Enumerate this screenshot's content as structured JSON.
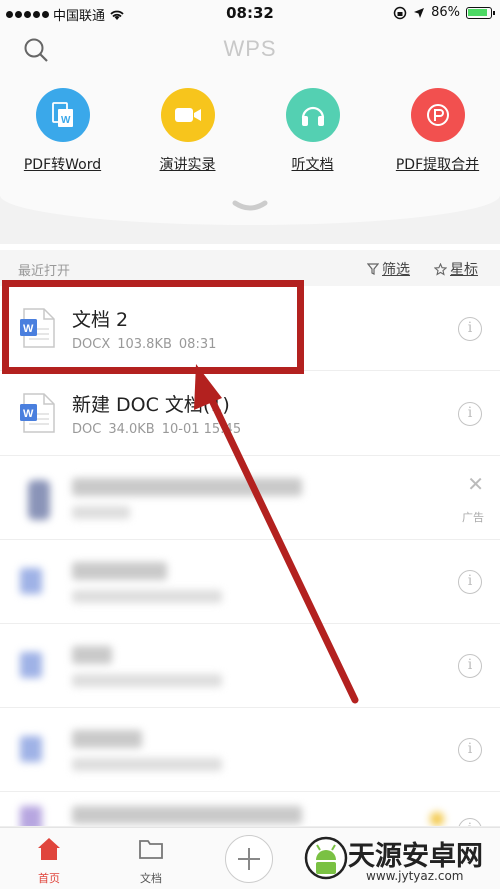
{
  "status_bar": {
    "carrier": "中国联通",
    "time": "08:32",
    "battery": "86%"
  },
  "header": {
    "logo": "WPS"
  },
  "tools": [
    {
      "label": "PDF转Word",
      "icon": "pdf-to-word-icon",
      "color": "#3aa8ea"
    },
    {
      "label": "演讲实录",
      "icon": "video-camera-icon",
      "color": "#f7c51c"
    },
    {
      "label": "听文档",
      "icon": "headphones-icon",
      "color": "#54d0b2"
    },
    {
      "label": "PDF提取合并",
      "icon": "pdf-merge-icon",
      "color": "#f2504f"
    }
  ],
  "section": {
    "title": "最近打开",
    "filter": "筛选",
    "star": "星标"
  },
  "files": [
    {
      "name": "文档 2",
      "type": "DOCX",
      "size": "103.8KB",
      "time": "08:31"
    },
    {
      "name": "新建 DOC 文档(1)",
      "type": "DOC",
      "size": "34.0KB",
      "time": "10-01 15:45"
    }
  ],
  "ad": {
    "label": "广告",
    "close": "✕"
  },
  "tabbar": {
    "home": "首页",
    "docs": "文档"
  },
  "watermark": {
    "brand": "天源安卓网",
    "url": "www.jytyaz.com"
  },
  "colors": {
    "highlight": "#b3211f",
    "home_tab": "#e0453c"
  }
}
